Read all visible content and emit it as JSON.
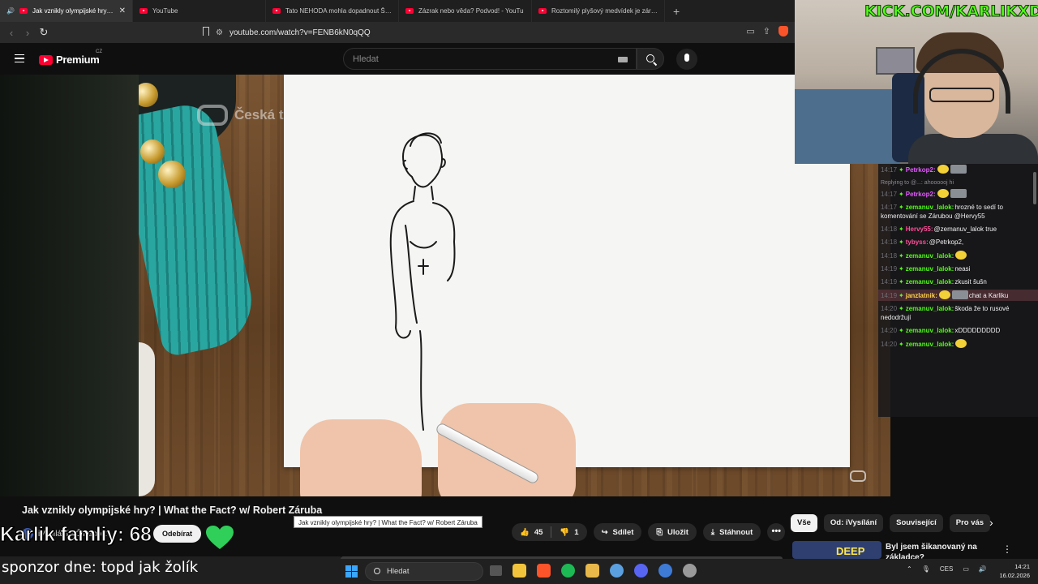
{
  "browser": {
    "tabs": [
      {
        "label": "Jak vznikly olympijské hry? | W",
        "active": true
      },
      {
        "label": "YouTube",
        "active": false
      },
      {
        "label": "Tato NEHODA mohla dopadnout ŠPA",
        "active": false
      },
      {
        "label": "Zázrak nebo věda? Podvod! - YouTu",
        "active": false
      },
      {
        "label": "Roztomilý plyšový medvídek je zárov",
        "active": false
      }
    ],
    "new_tab": "+",
    "url": "youtube.com/watch?v=FENB6kN0qQQ"
  },
  "youtube": {
    "logo_text": "Premium",
    "country": "CZ",
    "search_placeholder": "Hledat",
    "watermark": "Česká televize",
    "video_title": "Jak vznikly olympijské hry? | What the Fact? w/ Robert Záruba",
    "tooltip": "Jak vznikly olympijské hry? | What the Fact? w/ Robert Záruba",
    "channel_name": "iVysílání - ČT sport",
    "subscribe_label": "Odebírat",
    "likes": "45",
    "dislikes": "1",
    "share_label": "Sdílet",
    "save_label": "Uložit",
    "download_label": "Stáhnout",
    "more_label": "•••",
    "chips": [
      "Vše",
      "Od: iVysílání",
      "Související",
      "Pro vás"
    ],
    "rec_title": "Byl jsem šikanovaný na základce?",
    "rec_thumb_text": "DEEP"
  },
  "stream": {
    "kick_url": "KICK.COM/KARLIKXD",
    "overlay_name": "Karlik famliy: 68",
    "sponsor": "sponzor dne: topd jak žolík",
    "chat": [
      {
        "ts": "14:17",
        "user": "Petrkop2:",
        "color": "#e45bff",
        "text": "",
        "emotes": 2
      },
      {
        "reply": "Replying to @...: ahoooooj hi"
      },
      {
        "ts": "14:17",
        "user": "Petrkop2:",
        "color": "#e45bff",
        "text": "",
        "emotes": 2
      },
      {
        "ts": "14:17",
        "user": "zemanuv_lalok:",
        "color": "#53fc18",
        "text": "hrozné to sedí to komentování se Zárubou @Hervy55",
        "emotes": 0
      },
      {
        "ts": "14:18",
        "user": "Hervy55:",
        "color": "#ff4f9a",
        "text": "@zemanuv_lalok true",
        "emotes": 0
      },
      {
        "ts": "14:18",
        "user": "tybyss:",
        "color": "#ff4f9a",
        "text": "@Petrkop2,",
        "emotes": 0
      },
      {
        "ts": "14:18",
        "user": "zemanuv_lalok:",
        "color": "#53fc18",
        "text": "",
        "emotes": 1
      },
      {
        "ts": "14:19",
        "user": "zemanuv_lalok:",
        "color": "#53fc18",
        "text": "neasi",
        "emotes": 0
      },
      {
        "ts": "14:19",
        "user": "zemanuv_lalok:",
        "color": "#53fc18",
        "text": "zkusit šušn",
        "emotes": 0
      },
      {
        "ts": "14:19",
        "user": "janzlatnik:",
        "color": "#ffd24a",
        "text": "chat a Karliku",
        "emotes": 2,
        "highlight": true
      },
      {
        "ts": "14:20",
        "user": "zemanuv_lalok:",
        "color": "#53fc18",
        "text": "škoda že to rusové nedodržují",
        "emotes": 0
      },
      {
        "ts": "14:20",
        "user": "zemanuv_lalok:",
        "color": "#53fc18",
        "text": "xDDDDDDDDD",
        "emotes": 0
      },
      {
        "ts": "14:20",
        "user": "zemanuv_lalok:",
        "color": "#53fc18",
        "text": "",
        "emotes": 1
      }
    ]
  },
  "taskbar": {
    "search_placeholder": "Hledat",
    "lang": "CES",
    "time": "14:21",
    "date": "16.02.2026"
  },
  "colors": {
    "kick_green": "#53fc18",
    "yt_red": "#ff0033",
    "bg": "#0f0f0f"
  }
}
